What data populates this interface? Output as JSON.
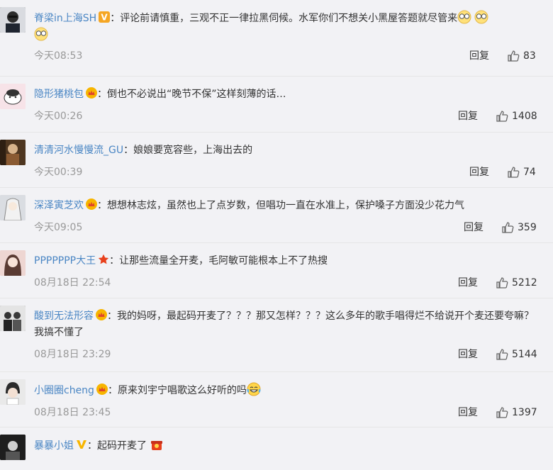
{
  "comments": [
    {
      "user": "脊梁in上海SH",
      "badge": "vip-v-orange",
      "text": "评论前请慎重，三观不正一律拉黑伺候。水军你们不想关小黑屋答题就尽管来",
      "emojis": [
        "glasses-face-emoji",
        "glasses-face-emoji",
        "glasses-face-emoji"
      ],
      "time": "今天08:53",
      "reply": "回复",
      "likes": "83"
    },
    {
      "user": "隐形猪桃包",
      "badge": "crown",
      "text": "倒也不必说出“晚节不保”这样刻薄的话…",
      "emojis": [],
      "time": "今天00:26",
      "reply": "回复",
      "likes": "1408"
    },
    {
      "user": "清清河水慢慢流_GU",
      "badge": "",
      "text": "娘娘要宽容些，上海出去的",
      "emojis": [],
      "time": "今天00:39",
      "reply": "回复",
      "likes": "74"
    },
    {
      "user": "深泽寅芝欢",
      "badge": "crown",
      "text": "想想林志炫，虽然也上了点岁数，但唱功一直在水准上，保护嗓子方面没少花力气",
      "emojis": [],
      "time": "今天09:05",
      "reply": "回复",
      "likes": "359"
    },
    {
      "user": "PPPPPPP大王",
      "badge": "star",
      "text": "让那些流量全开麦，毛阿敏可能根本上不了热搜",
      "emojis": [],
      "time": "08月18日 22:54",
      "reply": "回复",
      "likes": "5212"
    },
    {
      "user": "酸到无法形容",
      "badge": "crown",
      "text": "我的妈呀，最起码开麦了？？？那又怎样？？？这么多年的歌手唱得烂不给说开个麦还要夸嘛？我搞不懂了",
      "emojis": [],
      "time": "08月18日 23:29",
      "reply": "回复",
      "likes": "5144"
    },
    {
      "user": "小圈圈cheng",
      "badge": "crown",
      "text": "原来刘宇宁唱歌这么好听的吗",
      "emojis": [
        "laugh-cry-emoji"
      ],
      "time": "08月18日 23:45",
      "reply": "回复",
      "likes": "1397"
    },
    {
      "user": "暴暴小姐",
      "badge": "vip-v-yellow",
      "text": "起码开麦了",
      "emojis": [
        "red-gift-emoji"
      ],
      "time": "",
      "reply": "",
      "likes": ""
    }
  ],
  "colors": {
    "username": "#4a86c4",
    "background": "#f2f2f5",
    "divider": "#e6e6e6"
  }
}
